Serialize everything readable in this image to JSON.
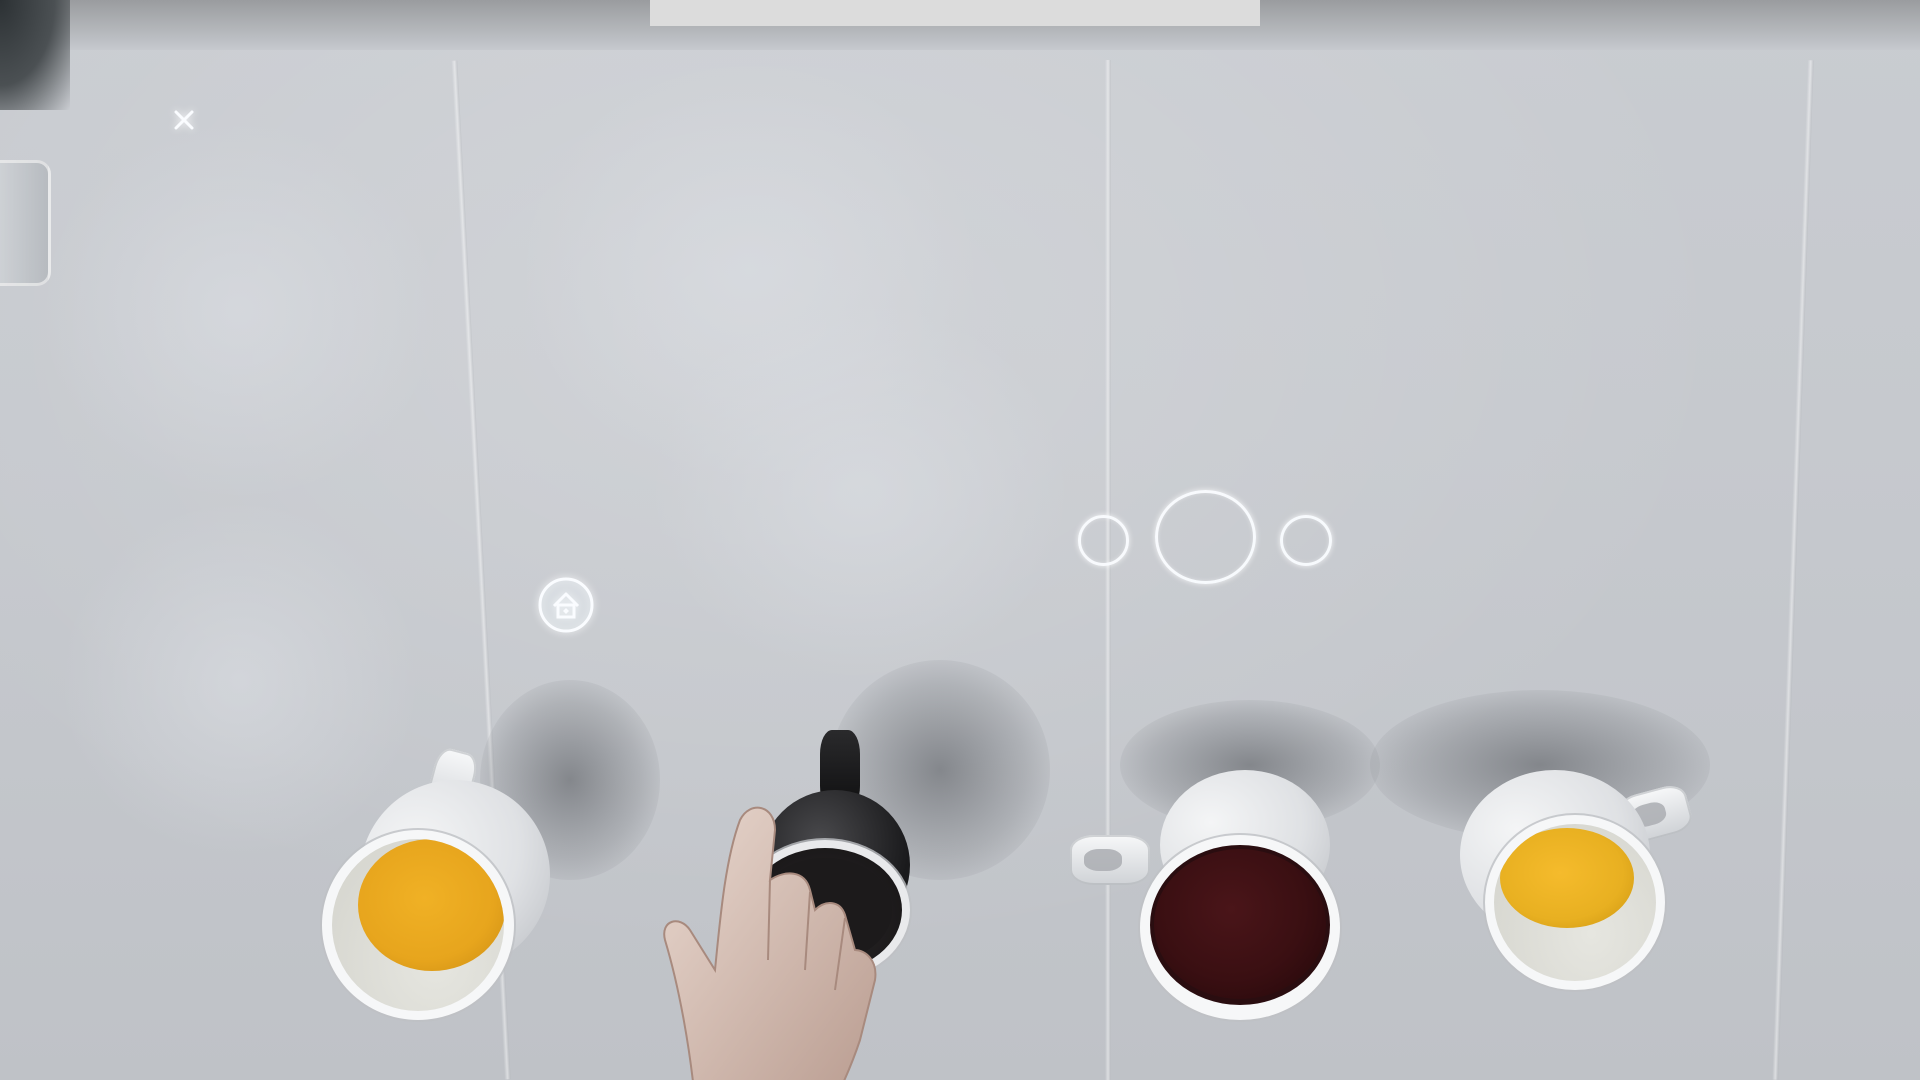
{
  "scene": {
    "description_type": "tabletop projection interface",
    "surface_color": "#c6c9ce"
  },
  "controls": {
    "close": {
      "icon": "close-icon",
      "glyph": "✕"
    },
    "home": {
      "icon": "home-icon"
    }
  },
  "pager": {
    "dots": [
      {
        "state": "inactive"
      },
      {
        "state": "active"
      },
      {
        "state": "inactive"
      }
    ],
    "active_index": 1
  },
  "cups": [
    {
      "name": "cup-orange-left",
      "liquid": "orange",
      "liquid_color": "#e7a51d"
    },
    {
      "name": "cup-dark-mug",
      "liquid": "dark",
      "liquid_color": "#1c1a1b"
    },
    {
      "name": "cup-dark-red",
      "liquid": "dark-red",
      "liquid_color": "#3a0f12"
    },
    {
      "name": "cup-orange-right",
      "liquid": "orange",
      "liquid_color": "#e8b021"
    }
  ],
  "colors": {
    "ui_stroke": "#fafcff",
    "juice": "#e7a51d",
    "cola": "#3a0f12",
    "cup": "#f4f5f6"
  }
}
